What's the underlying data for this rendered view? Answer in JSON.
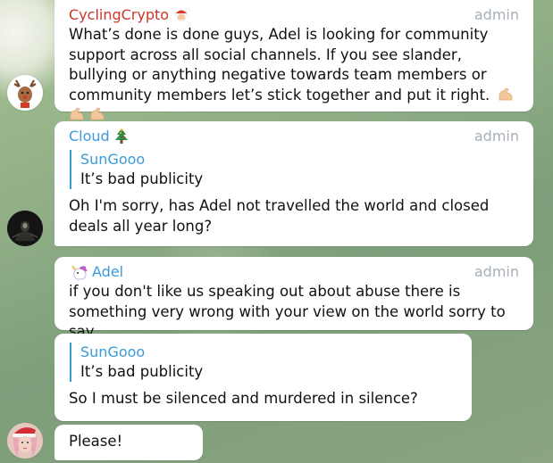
{
  "colors": {
    "cyclingcrypto": "#c9372c",
    "cloud": "#3a9bd9",
    "adel": "#3a9bd9",
    "admin_tag": "#a7b0b8",
    "quote_accent": "#3a9bd9"
  },
  "messages": [
    {
      "sender": "CyclingCrypto",
      "sender_emoji": "santa-icon",
      "tag": "admin",
      "text": "What’s done is done guys, Adel is looking for community support across all social channels. If you see slander, bullying or anything negative towards team members or community members let’s stick together and put it right.",
      "trailing_emoji": "flexed-biceps-icon ×3"
    },
    {
      "sender": "Cloud",
      "sender_emoji": "christmas-tree-icon",
      "tag": "admin",
      "reply_to": {
        "name": "SunGooo",
        "text": "It’s bad publicity"
      },
      "text": "Oh I'm sorry, has Adel not travelled the world and closed deals all year long?"
    },
    {
      "sender": "Adel",
      "sender_emoji": "unicorn-icon",
      "tag": "admin",
      "text": "if you don't like us speaking out about abuse there is something very wrong with your view on the world sorry to say"
    },
    {
      "reply_to": {
        "name": "SunGooo",
        "text": "It’s bad publicity"
      },
      "text": "So I must be silenced and murdered in silence?"
    },
    {
      "text": "Please!"
    }
  ]
}
